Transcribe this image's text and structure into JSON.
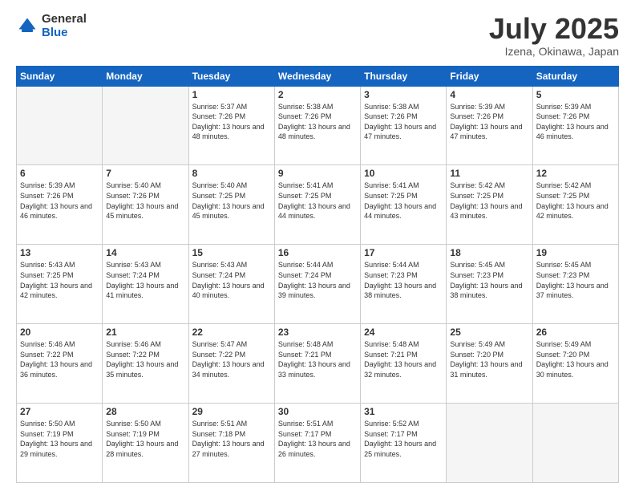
{
  "header": {
    "logo_general": "General",
    "logo_blue": "Blue",
    "title": "July 2025",
    "location": "Izena, Okinawa, Japan"
  },
  "weekdays": [
    "Sunday",
    "Monday",
    "Tuesday",
    "Wednesday",
    "Thursday",
    "Friday",
    "Saturday"
  ],
  "weeks": [
    [
      {
        "day": "",
        "empty": true
      },
      {
        "day": "",
        "empty": true
      },
      {
        "day": "1",
        "sunrise": "5:37 AM",
        "sunset": "7:26 PM",
        "daylight": "13 hours and 48 minutes."
      },
      {
        "day": "2",
        "sunrise": "5:38 AM",
        "sunset": "7:26 PM",
        "daylight": "13 hours and 48 minutes."
      },
      {
        "day": "3",
        "sunrise": "5:38 AM",
        "sunset": "7:26 PM",
        "daylight": "13 hours and 47 minutes."
      },
      {
        "day": "4",
        "sunrise": "5:39 AM",
        "sunset": "7:26 PM",
        "daylight": "13 hours and 47 minutes."
      },
      {
        "day": "5",
        "sunrise": "5:39 AM",
        "sunset": "7:26 PM",
        "daylight": "13 hours and 46 minutes."
      }
    ],
    [
      {
        "day": "6",
        "sunrise": "5:39 AM",
        "sunset": "7:26 PM",
        "daylight": "13 hours and 46 minutes."
      },
      {
        "day": "7",
        "sunrise": "5:40 AM",
        "sunset": "7:26 PM",
        "daylight": "13 hours and 45 minutes."
      },
      {
        "day": "8",
        "sunrise": "5:40 AM",
        "sunset": "7:25 PM",
        "daylight": "13 hours and 45 minutes."
      },
      {
        "day": "9",
        "sunrise": "5:41 AM",
        "sunset": "7:25 PM",
        "daylight": "13 hours and 44 minutes."
      },
      {
        "day": "10",
        "sunrise": "5:41 AM",
        "sunset": "7:25 PM",
        "daylight": "13 hours and 44 minutes."
      },
      {
        "day": "11",
        "sunrise": "5:42 AM",
        "sunset": "7:25 PM",
        "daylight": "13 hours and 43 minutes."
      },
      {
        "day": "12",
        "sunrise": "5:42 AM",
        "sunset": "7:25 PM",
        "daylight": "13 hours and 42 minutes."
      }
    ],
    [
      {
        "day": "13",
        "sunrise": "5:43 AM",
        "sunset": "7:25 PM",
        "daylight": "13 hours and 42 minutes."
      },
      {
        "day": "14",
        "sunrise": "5:43 AM",
        "sunset": "7:24 PM",
        "daylight": "13 hours and 41 minutes."
      },
      {
        "day": "15",
        "sunrise": "5:43 AM",
        "sunset": "7:24 PM",
        "daylight": "13 hours and 40 minutes."
      },
      {
        "day": "16",
        "sunrise": "5:44 AM",
        "sunset": "7:24 PM",
        "daylight": "13 hours and 39 minutes."
      },
      {
        "day": "17",
        "sunrise": "5:44 AM",
        "sunset": "7:23 PM",
        "daylight": "13 hours and 38 minutes."
      },
      {
        "day": "18",
        "sunrise": "5:45 AM",
        "sunset": "7:23 PM",
        "daylight": "13 hours and 38 minutes."
      },
      {
        "day": "19",
        "sunrise": "5:45 AM",
        "sunset": "7:23 PM",
        "daylight": "13 hours and 37 minutes."
      }
    ],
    [
      {
        "day": "20",
        "sunrise": "5:46 AM",
        "sunset": "7:22 PM",
        "daylight": "13 hours and 36 minutes."
      },
      {
        "day": "21",
        "sunrise": "5:46 AM",
        "sunset": "7:22 PM",
        "daylight": "13 hours and 35 minutes."
      },
      {
        "day": "22",
        "sunrise": "5:47 AM",
        "sunset": "7:22 PM",
        "daylight": "13 hours and 34 minutes."
      },
      {
        "day": "23",
        "sunrise": "5:48 AM",
        "sunset": "7:21 PM",
        "daylight": "13 hours and 33 minutes."
      },
      {
        "day": "24",
        "sunrise": "5:48 AM",
        "sunset": "7:21 PM",
        "daylight": "13 hours and 32 minutes."
      },
      {
        "day": "25",
        "sunrise": "5:49 AM",
        "sunset": "7:20 PM",
        "daylight": "13 hours and 31 minutes."
      },
      {
        "day": "26",
        "sunrise": "5:49 AM",
        "sunset": "7:20 PM",
        "daylight": "13 hours and 30 minutes."
      }
    ],
    [
      {
        "day": "27",
        "sunrise": "5:50 AM",
        "sunset": "7:19 PM",
        "daylight": "13 hours and 29 minutes."
      },
      {
        "day": "28",
        "sunrise": "5:50 AM",
        "sunset": "7:19 PM",
        "daylight": "13 hours and 28 minutes."
      },
      {
        "day": "29",
        "sunrise": "5:51 AM",
        "sunset": "7:18 PM",
        "daylight": "13 hours and 27 minutes."
      },
      {
        "day": "30",
        "sunrise": "5:51 AM",
        "sunset": "7:17 PM",
        "daylight": "13 hours and 26 minutes."
      },
      {
        "day": "31",
        "sunrise": "5:52 AM",
        "sunset": "7:17 PM",
        "daylight": "13 hours and 25 minutes."
      },
      {
        "day": "",
        "empty": true
      },
      {
        "day": "",
        "empty": true
      }
    ]
  ]
}
